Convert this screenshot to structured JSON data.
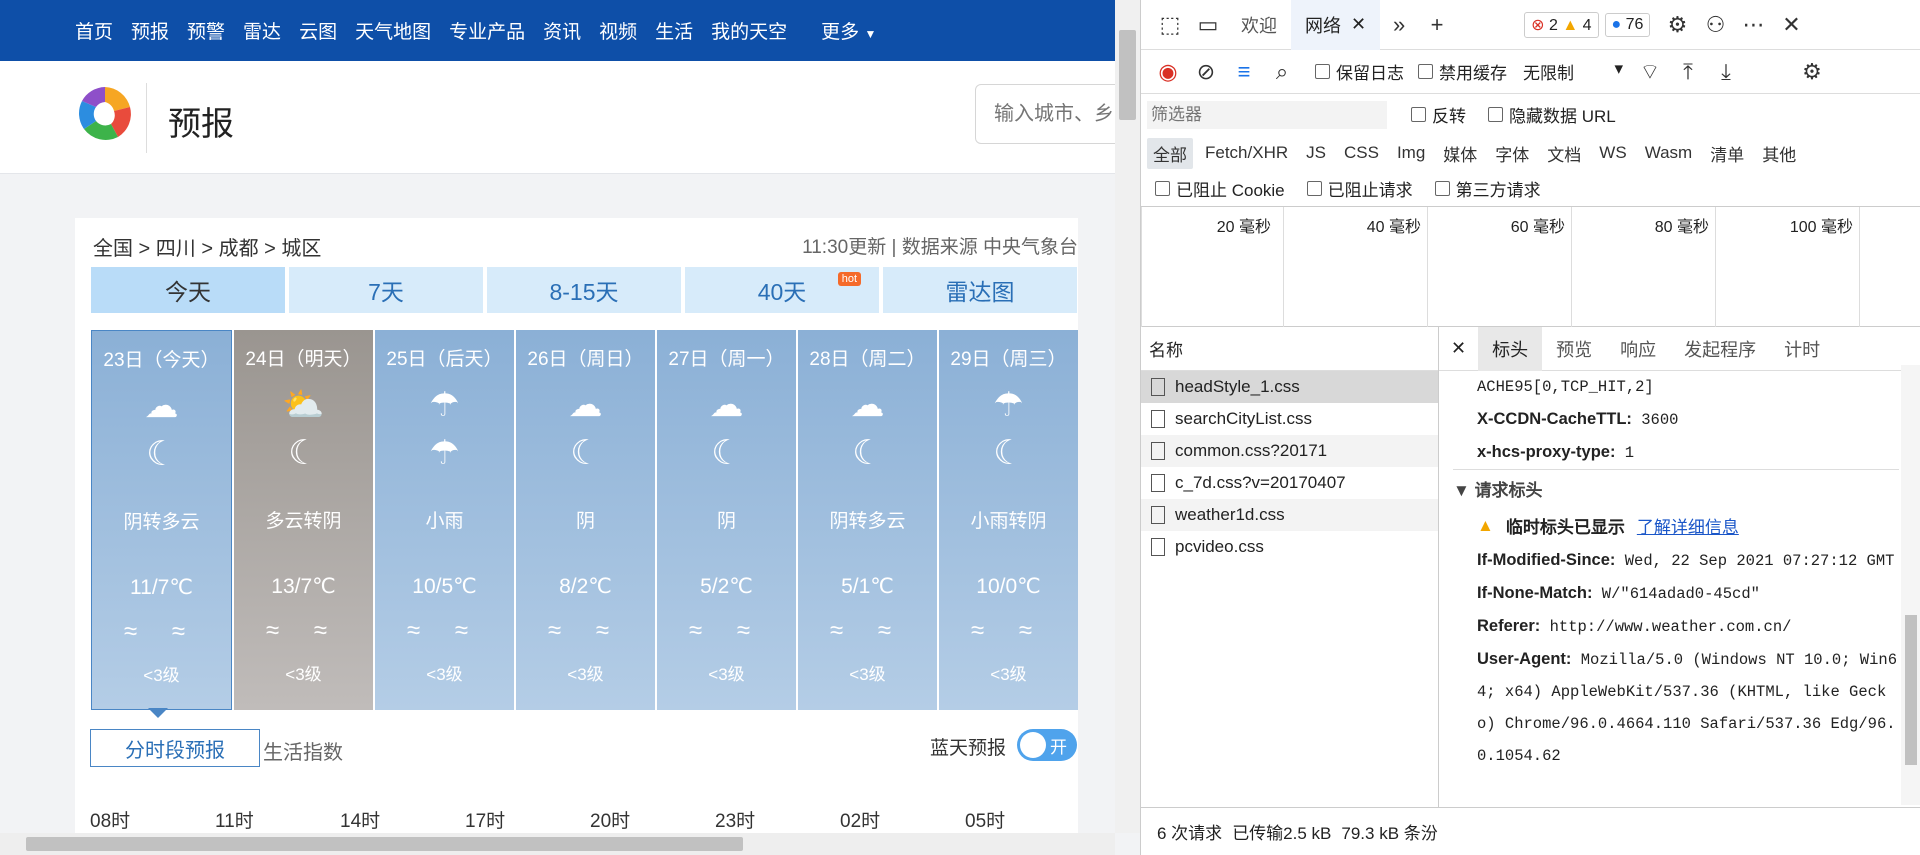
{
  "nav": {
    "items": [
      "首页",
      "预报",
      "预警",
      "雷达",
      "云图",
      "天气地图",
      "专业产品",
      "资讯",
      "视频",
      "生活",
      "我的天空"
    ],
    "more": "更多"
  },
  "brand": {
    "title": "预报",
    "search_placeholder": "输入城市、乡"
  },
  "breadcrumb": "全国 > 四川 > 成都 > 城区",
  "update": "11:30更新 | 数据来源 中央气象台",
  "tabs": [
    "今天",
    "7天",
    "8-15天",
    "40天",
    "雷达图"
  ],
  "hot": "hot",
  "days": [
    {
      "date": "23日（今天）",
      "icon1": "cloud",
      "icon2": "cloud-moon",
      "desc": "阴转多云",
      "temp": "11/7℃",
      "wind": "≈ ≈",
      "level": "<3级"
    },
    {
      "date": "24日（明天）",
      "icon1": "sun-cloud",
      "icon2": "cloud-moon",
      "desc": "多云转阴",
      "temp": "13/7℃",
      "wind": "≈ ≈",
      "level": "<3级"
    },
    {
      "date": "25日（后天）",
      "icon1": "rain",
      "icon2": "rain",
      "desc": "小雨",
      "temp": "10/5℃",
      "wind": "≈ ≈",
      "level": "<3级"
    },
    {
      "date": "26日（周日）",
      "icon1": "cloud",
      "icon2": "cloud-moon",
      "desc": "阴",
      "temp": "8/2℃",
      "wind": "≈ ≈",
      "level": "<3级"
    },
    {
      "date": "27日（周一）",
      "icon1": "cloud",
      "icon2": "cloud-moon",
      "desc": "阴",
      "temp": "5/2℃",
      "wind": "≈ ≈",
      "level": "<3级"
    },
    {
      "date": "28日（周二）",
      "icon1": "cloud",
      "icon2": "cloud-moon",
      "desc": "阴转多云",
      "temp": "5/1℃",
      "wind": "≈ ≈",
      "level": "<3级"
    },
    {
      "date": "29日（周三）",
      "icon1": "rain",
      "icon2": "cloud-moon",
      "desc": "小雨转阴",
      "temp": "10/0℃",
      "wind": "≈ ≈",
      "level": "<3级"
    }
  ],
  "subtab": "分时段预报",
  "life": "生活指数",
  "blue_label": "蓝天预报",
  "toggle": "开",
  "hours": [
    "08时",
    "11时",
    "14时",
    "17时",
    "20时",
    "23时",
    "02时",
    "05时"
  ],
  "devtools": {
    "tabs": [
      "欢迎",
      "网络"
    ],
    "errors": "2",
    "warnings": "4",
    "messages": "76",
    "preserve_log": "保留日志",
    "disable_cache": "禁用缓存",
    "throttle": "无限制",
    "filter_placeholder": "筛选器",
    "invert": "反转",
    "hide_data": "隐藏数据 URL",
    "types": [
      "全部",
      "Fetch/XHR",
      "JS",
      "CSS",
      "Img",
      "媒体",
      "字体",
      "文档",
      "WS",
      "Wasm",
      "清单",
      "其他"
    ],
    "blocked_cookie": "已阻止 Cookie",
    "blocked_req": "已阻止请求",
    "third_party": "第三方请求",
    "timeline": [
      "20 毫秒",
      "40 毫秒",
      "60 毫秒",
      "80 毫秒",
      "100 毫秒"
    ],
    "name_header": "名称",
    "files": [
      "headStyle_1.css",
      "searchCityList.css",
      "common.css?20171",
      "c_7d.css?v=20170407",
      "weather1d.css",
      "pcvideo.css"
    ],
    "detail_tabs": [
      "标头",
      "预览",
      "响应",
      "发起程序",
      "计时"
    ],
    "headers_top": "ACHE95[0,TCP_HIT,2]",
    "h1k": "X-CCDN-CacheTTL:",
    "h1v": "3600",
    "h2k": "x-hcs-proxy-type:",
    "h2v": "1",
    "req_section": "请求标头",
    "warn_text": "临时标头已显示",
    "warn_link": "了解详细信息",
    "h3k": "If-Modified-Since:",
    "h3v": "Wed, 22 Sep 2021 07:27:12 GMT",
    "h4k": "If-None-Match:",
    "h4v": "W/\"614adad0-45cd\"",
    "h5k": "Referer:",
    "h5v": "http://www.weather.com.cn/",
    "h6k": "User-Agent:",
    "h6v": "Mozilla/5.0 (Windows NT 10.0; Win64; x64) AppleWebKit/537.36 (KHTML, like Gecko) Chrome/96.0.4664.110 Safari/537.36 Edg/96.0.1054.62",
    "status": [
      "6 次请求",
      "已传输2.5 kB",
      "79.3 kB 条汾"
    ]
  }
}
